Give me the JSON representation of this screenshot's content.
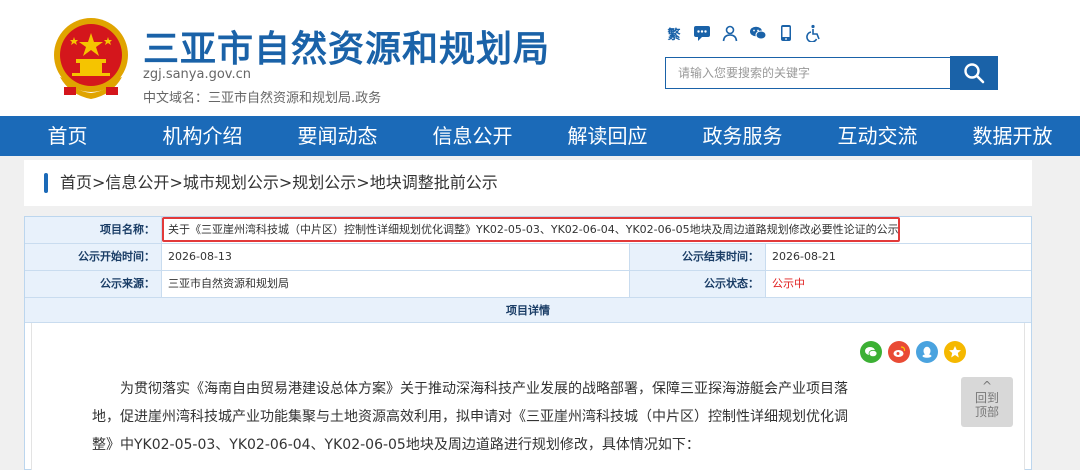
{
  "header": {
    "title": "三亚市自然资源和规划局",
    "domain": "zgj.sanya.gov.cn",
    "cn_domain": "中文域名：三亚市自然资源和规划局.政务",
    "traditional_label": "繁",
    "search_placeholder": "请输入您要搜索的关键字"
  },
  "nav": {
    "items": [
      "首页",
      "机构介绍",
      "要闻动态",
      "信息公开",
      "解读回应",
      "政务服务",
      "互动交流",
      "数据开放"
    ]
  },
  "breadcrumb": {
    "items": [
      "首页",
      "信息公开",
      "城市规划公示",
      "规划公示",
      "地块调整批前公示"
    ],
    "separator": ">"
  },
  "info": {
    "project_name_label": "项目名称：",
    "project_name": "关于《三亚崖州湾科技城（中片区）控制性详细规划优化调整》YK02-05-03、YK02-06-04、YK02-06-05地块及周边道路规划修改必要性论证的公示",
    "start_label": "公示开始时间：",
    "start_date": "2026-08-13",
    "end_label": "公示结束时间：",
    "end_date": "2026-08-21",
    "source_label": "公示来源：",
    "source": "三亚市自然资源和规划局",
    "status_label": "公示状态：",
    "status": "公示中",
    "status_color": "#e02020",
    "detail_header": "项目详情"
  },
  "detail": {
    "paragraph": "为贯彻落实《海南自由贸易港建设总体方案》关于推动深海科技产业发展的战略部署，保障三亚探海游艇会产业项目落地，促进崖州湾科技城产业功能集聚与土地资源高效利用，拟申请对《三亚崖州湾科技城（中片区）控制性详细规划优化调整》中YK02-05-03、YK02-06-04、YK02-06-05地块及周边道路进行规划修改，具体情况如下："
  },
  "back_to_top": {
    "line1": "回到",
    "line2": "顶部",
    "arrow": "^"
  },
  "colors": {
    "brand": "#1a62a8",
    "nav": "#1b6ab8",
    "highlight": "#e23a3a"
  }
}
